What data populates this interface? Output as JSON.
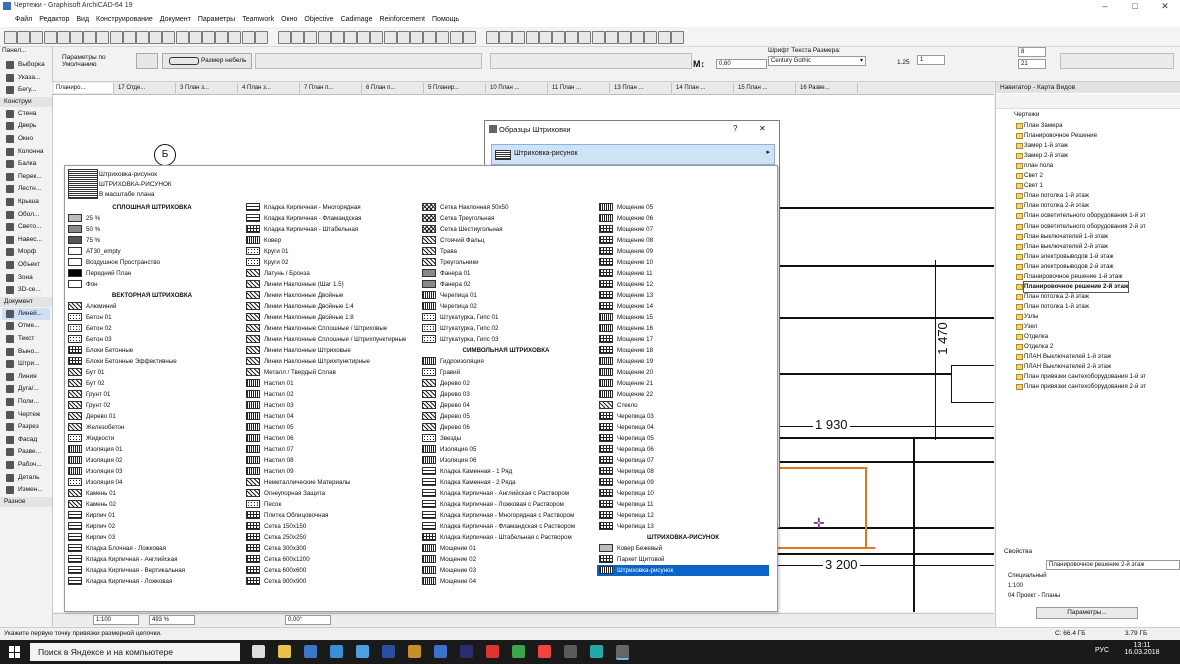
{
  "window": {
    "title": "Чертежи - Graphisoft ArchiCAD-64 19"
  },
  "menu": [
    "Файл",
    "Редактор",
    "Вид",
    "Конструирование",
    "Документ",
    "Параметры",
    "Teamwork",
    "Окно",
    "Objective",
    "Cadimage",
    "Reinforcement",
    "Помощь"
  ],
  "infobox": {
    "params_label": "Параметры по Умолчанию",
    "razmer": "Размер небель",
    "field_val": "0,60",
    "font_label": "Шрифт Текста Размера:",
    "font_value": "Century Gothic",
    "val_a": "1.25",
    "val_b": "1",
    "val_c": "21",
    "val_d": "8"
  },
  "toolbox": {
    "header": "Панел...",
    "items": [
      {
        "label": "Выборка",
        "section": false
      },
      {
        "label": "Указа...",
        "section": false
      },
      {
        "label": "Бегу...",
        "section": false
      },
      {
        "label": "Конструи",
        "section": true
      },
      {
        "label": "Стена",
        "section": false
      },
      {
        "label": "Дверь",
        "section": false
      },
      {
        "label": "Окно",
        "section": false
      },
      {
        "label": "Колонна",
        "section": false
      },
      {
        "label": "Балка",
        "section": false
      },
      {
        "label": "Перек...",
        "section": false
      },
      {
        "label": "Лестн...",
        "section": false
      },
      {
        "label": "Крыша",
        "section": false
      },
      {
        "label": "Обол...",
        "section": false
      },
      {
        "label": "Свето...",
        "section": false
      },
      {
        "label": "Навес...",
        "section": false
      },
      {
        "label": "Морф",
        "section": false
      },
      {
        "label": "Объект",
        "section": false
      },
      {
        "label": "Зона",
        "section": false
      },
      {
        "label": "3D-се...",
        "section": false
      },
      {
        "label": "Документ",
        "section": true
      },
      {
        "label": "Линей...",
        "section": false
      },
      {
        "label": "Отме...",
        "section": false
      },
      {
        "label": "Текст",
        "section": false
      },
      {
        "label": "Выно...",
        "section": false
      },
      {
        "label": "Штри...",
        "section": false
      },
      {
        "label": "Линия",
        "section": false
      },
      {
        "label": "Дуга/...",
        "section": false
      },
      {
        "label": "Поли...",
        "section": false
      },
      {
        "label": "Чертеж",
        "section": false
      },
      {
        "label": "Разрез",
        "section": false
      },
      {
        "label": "Фасад",
        "section": false
      },
      {
        "label": "Разве...",
        "section": false
      },
      {
        "label": "Рабоч...",
        "section": false
      },
      {
        "label": "Деталь",
        "section": false
      },
      {
        "label": "Измен...",
        "section": false
      },
      {
        "label": "Разное",
        "section": true
      }
    ]
  },
  "tabs": [
    "Планиро...",
    "17 Отде...",
    "3 План з...",
    "4 План з...",
    "7 План п...",
    "6 План п...",
    "5 Планир...",
    "10 План ...",
    "11 План ...",
    "13 План ...",
    "14 План ...",
    "15 План ...",
    "16 Разве..."
  ],
  "drawing": {
    "marker": "Б",
    "dim_1470": "1 470",
    "dim_1930": "1 930",
    "dim_3200": "3 200"
  },
  "dialog": {
    "title": "Образцы Штриховки",
    "help": "?",
    "close": "✕",
    "selected": "Штриховка-рисунок"
  },
  "popup": {
    "preview": [
      "Штриховка-рисунок",
      "ШТРИХОВКА-РИСУНОК",
      "В масштабе плана"
    ],
    "columns": [
      [
        {
          "t": "СПЛОШНАЯ ШТРИХОВКА",
          "h": true
        },
        {
          "t": "25 %",
          "p": "g25"
        },
        {
          "t": "50 %",
          "p": "g50"
        },
        {
          "t": "75 %",
          "p": "g75"
        },
        {
          "t": "AT30_empty",
          "p": "empty"
        },
        {
          "t": "Воздушное Пространство",
          "p": "empty"
        },
        {
          "t": "Передний План",
          "p": "black"
        },
        {
          "t": "Фон",
          "p": "empty"
        },
        {
          "t": "ВЕКТОРНАЯ ШТРИХОВКА",
          "h": true
        },
        {
          "t": "Алюминий",
          "p": "diag"
        },
        {
          "t": "Бетон 01",
          "p": "dots"
        },
        {
          "t": "Бетон 02",
          "p": "dots"
        },
        {
          "t": "Бетон 03",
          "p": "dots"
        },
        {
          "t": "Блоки Бетонные",
          "p": "grid"
        },
        {
          "t": "Блоки Бетонные Эффективные",
          "p": "grid"
        },
        {
          "t": "Бут 01",
          "p": "diag"
        },
        {
          "t": "Бут 02",
          "p": "diag"
        },
        {
          "t": "Грунт 01",
          "p": "diag"
        },
        {
          "t": "Грунт 02",
          "p": "diag"
        },
        {
          "t": "Дерево 01",
          "p": "diag"
        },
        {
          "t": "Железобетон",
          "p": "diag"
        },
        {
          "t": "Жидкости",
          "p": "dots"
        },
        {
          "t": "Изоляция 01",
          "p": "dense"
        },
        {
          "t": "Изоляция 02",
          "p": "dense"
        },
        {
          "t": "Изоляция 03",
          "p": "dense"
        },
        {
          "t": "Изоляция 04",
          "p": "dots"
        },
        {
          "t": "Камень 01",
          "p": "diag"
        },
        {
          "t": "Камень 02",
          "p": "diag"
        },
        {
          "t": "Кирпич 01",
          "p": "brick"
        },
        {
          "t": "Кирпич 02",
          "p": "brick"
        },
        {
          "t": "Кирпич 03",
          "p": "brick"
        },
        {
          "t": "Кладка Блочная - Ложковая",
          "p": "brick"
        },
        {
          "t": "Кладка Кирпичная - Английская",
          "p": "brick"
        },
        {
          "t": "Кладка Кирпичная - Вертикальная",
          "p": "brick"
        },
        {
          "t": "Кладка Кирпичная - Ложковая",
          "p": "brick"
        }
      ],
      [
        {
          "t": "Кладка Кирпичная - Многорядная",
          "p": "brick"
        },
        {
          "t": "Кладка Кирпичная - Фламандская",
          "p": "brick"
        },
        {
          "t": "Кладка Кирпичная - Штабельная",
          "p": "grid"
        },
        {
          "t": "Ковер",
          "p": "dense"
        },
        {
          "t": "Круги 01",
          "p": "dots"
        },
        {
          "t": "Круги 02",
          "p": "dots"
        },
        {
          "t": "Латунь / Бронза",
          "p": "diag"
        },
        {
          "t": "Линии Наклонные (Шаг 1.5)",
          "p": "diag"
        },
        {
          "t": "Линии Наклонные Двойные",
          "p": "diag"
        },
        {
          "t": "Линии Наклонные Двойные 1:4",
          "p": "diag"
        },
        {
          "t": "Линии Наклонные Двойные 1:8",
          "p": "diag"
        },
        {
          "t": "Линии Наклонные Сплошные / Штриховые",
          "p": "diag"
        },
        {
          "t": "Линии Наклонные Сплошные / Штрихпунктирные",
          "p": "diag"
        },
        {
          "t": "Линии Наклонные Штриховые",
          "p": "diag"
        },
        {
          "t": "Линии Наклонные Штрихпунктирные",
          "p": "diag"
        },
        {
          "t": "Металл / Твердый Сплав",
          "p": "diag"
        },
        {
          "t": "Настил 01",
          "p": "dense"
        },
        {
          "t": "Настил 02",
          "p": "dense"
        },
        {
          "t": "Настил 03",
          "p": "dense"
        },
        {
          "t": "Настил 04",
          "p": "dense"
        },
        {
          "t": "Настил 05",
          "p": "dense"
        },
        {
          "t": "Настил 06",
          "p": "dense"
        },
        {
          "t": "Настил 07",
          "p": "dense"
        },
        {
          "t": "Настил 08",
          "p": "dense"
        },
        {
          "t": "Настил 09",
          "p": "dense"
        },
        {
          "t": "Неметаллические Материалы",
          "p": "diag"
        },
        {
          "t": "Огнеупорная Защита",
          "p": "diag"
        },
        {
          "t": "Песок",
          "p": "dots"
        },
        {
          "t": "Плитка Облицовочная",
          "p": "grid"
        },
        {
          "t": "Сетка 150x150",
          "p": "grid"
        },
        {
          "t": "Сетка 250x250",
          "p": "grid"
        },
        {
          "t": "Сетка 300x300",
          "p": "grid"
        },
        {
          "t": "Сетка 600x1200",
          "p": "grid"
        },
        {
          "t": "Сетка 600x600",
          "p": "grid"
        },
        {
          "t": "Сетка 900x900",
          "p": "grid"
        }
      ],
      [
        {
          "t": "Сетка Наклонная 50x50",
          "p": "cross"
        },
        {
          "t": "Сетка Треугольная",
          "p": "cross"
        },
        {
          "t": "Сетка Шестиугольная",
          "p": "cross"
        },
        {
          "t": "Стоячий Фальц",
          "p": "diag"
        },
        {
          "t": "Трава",
          "p": "diag"
        },
        {
          "t": "Треугольники",
          "p": "diag"
        },
        {
          "t": "Фанера 01",
          "p": "g50"
        },
        {
          "t": "Фанера 02",
          "p": "g50"
        },
        {
          "t": "Черепица 01",
          "p": "dense"
        },
        {
          "t": "Черепица 02",
          "p": "dense"
        },
        {
          "t": "Штукатурка, Гипс 01",
          "p": "dots"
        },
        {
          "t": "Штукатурка, Гипс 02",
          "p": "dots"
        },
        {
          "t": "Штукатурка, Гипс 03",
          "p": "dots"
        },
        {
          "t": "СИМВОЛЬНАЯ ШТРИХОВКА",
          "h": true
        },
        {
          "t": "Гидроизоляция",
          "p": "dense"
        },
        {
          "t": "Гравий",
          "p": "dots"
        },
        {
          "t": "Дерево 02",
          "p": "diag"
        },
        {
          "t": "Дерево 03",
          "p": "diag"
        },
        {
          "t": "Дерево 04",
          "p": "diag"
        },
        {
          "t": "Дерево 05",
          "p": "diag"
        },
        {
          "t": "Дерево 06",
          "p": "diag"
        },
        {
          "t": "Звезды",
          "p": "dots"
        },
        {
          "t": "Изоляция 05",
          "p": "dense"
        },
        {
          "t": "Изоляция 06",
          "p": "dense"
        },
        {
          "t": "Кладка Каменная - 1 Ряд",
          "p": "brick"
        },
        {
          "t": "Кладка Каменная - 2 Ряда",
          "p": "brick"
        },
        {
          "t": "Кладка Кирпичная - Английская с Раствором",
          "p": "brick"
        },
        {
          "t": "Кладка Кирпичная - Ложковая с Раствором",
          "p": "brick"
        },
        {
          "t": "Кладка Кирпичная - Многорядная с Раствором",
          "p": "brick"
        },
        {
          "t": "Кладка Кирпичная - Фламандская с Раствором",
          "p": "brick"
        },
        {
          "t": "Кладка Кирпичная - Штабельная с Раствором",
          "p": "grid"
        },
        {
          "t": "Мощение 01",
          "p": "dense"
        },
        {
          "t": "Мощение 02",
          "p": "dense"
        },
        {
          "t": "Мощение 03",
          "p": "dense"
        },
        {
          "t": "Мощение 04",
          "p": "dense"
        }
      ],
      [
        {
          "t": "Мощение 05",
          "p": "dense"
        },
        {
          "t": "Мощение 06",
          "p": "dense"
        },
        {
          "t": "Мощение 07",
          "p": "grid"
        },
        {
          "t": "Мощение 08",
          "p": "grid"
        },
        {
          "t": "Мощение 09",
          "p": "grid"
        },
        {
          "t": "Мощение 10",
          "p": "grid"
        },
        {
          "t": "Мощение 11",
          "p": "grid"
        },
        {
          "t": "Мощение 12",
          "p": "grid"
        },
        {
          "t": "Мощение 13",
          "p": "grid"
        },
        {
          "t": "Мощение 14",
          "p": "grid"
        },
        {
          "t": "Мощение 15",
          "p": "dense"
        },
        {
          "t": "Мощение 16",
          "p": "dense"
        },
        {
          "t": "Мощение 17",
          "p": "grid"
        },
        {
          "t": "Мощение 18",
          "p": "grid"
        },
        {
          "t": "Мощение 19",
          "p": "dense"
        },
        {
          "t": "Мощение 20",
          "p": "dense"
        },
        {
          "t": "Мощение 21",
          "p": "dense"
        },
        {
          "t": "Мощение 22",
          "p": "dense"
        },
        {
          "t": "Стекло",
          "p": "diag"
        },
        {
          "t": "Черепица 03",
          "p": "grid"
        },
        {
          "t": "Черепица 04",
          "p": "grid"
        },
        {
          "t": "Черепица 05",
          "p": "grid"
        },
        {
          "t": "Черепица 06",
          "p": "grid"
        },
        {
          "t": "Черепица 07",
          "p": "grid"
        },
        {
          "t": "Черепица 08",
          "p": "grid"
        },
        {
          "t": "Черепица 09",
          "p": "grid"
        },
        {
          "t": "Черепица 10",
          "p": "grid"
        },
        {
          "t": "Черепица 11",
          "p": "grid"
        },
        {
          "t": "Черепица 12",
          "p": "grid"
        },
        {
          "t": "Черепица 13",
          "p": "grid"
        },
        {
          "t": "ШТРИХОВКА-РИСУНОК",
          "h": true
        },
        {
          "t": "Ковер Бежевый",
          "p": "g25"
        },
        {
          "t": "Паркет Щитовой",
          "p": "grid"
        },
        {
          "t": "Штриховка-рисунок",
          "p": "dense",
          "sel": true
        }
      ]
    ]
  },
  "navigator": {
    "title": "Навигатор - Карта Видов",
    "root": "Чертежи",
    "items": [
      "План Замера",
      "Планировочное Решение",
      "Замер 1-й этаж",
      "Замер 2-й этаж",
      "план пола",
      "Свет 2",
      "Свет 1",
      "План потолка 1-й этаж",
      "План потолка 2-й этаж",
      "План осветительного оборудования 1-й эт",
      "План осветительного оборудования 2-й эт",
      "План выключателей 1-й этаж",
      "План выключателей 2-й этаж",
      "План электровыводов 1-й этаж",
      "План электровыводов 2-й этаж",
      "Планировочное решение 1-й этаж",
      "Планировочное решение 2-й этаж",
      "План потолка 2-й этаж",
      "План потолка 1-й этаж",
      "Узлы",
      "Узел",
      "Отделка",
      "Отделка 2",
      "ПЛАН Выключателей 1-й этаж",
      "ПЛАН Выключателей 2-й этаж",
      "План привязки сантехоборудования 1-й эт",
      "План привязки сантехоборудования 2-й эт"
    ],
    "active_index": 16,
    "props_label": "Свойства",
    "props_value": "Планировочное решение 2-й этаж",
    "props_special": "Специальный",
    "props_scale": "1:100",
    "props_project": "04 Проект - Планы",
    "params_button": "Параметры..."
  },
  "canvas_bar": {
    "scale": "1:100",
    "zoom": "493 %",
    "angle": "0,00°"
  },
  "status": {
    "hint": "Укажите первую точку привязки размерной цепочки.",
    "disk_c": "C: 66.4 ГБ",
    "ram": "3.79 ГБ"
  },
  "taskbar": {
    "search": "Поиск в Яндексе и на компьютере",
    "time": "13:11",
    "date": "16.03.2018",
    "lang": "РУС"
  }
}
